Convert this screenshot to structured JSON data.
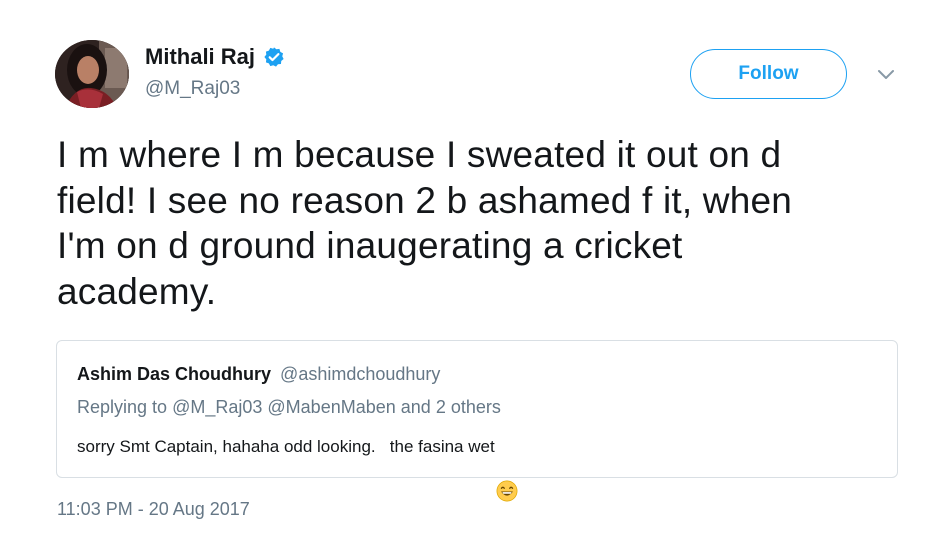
{
  "author": {
    "display_name": "Mithali Raj",
    "handle": "@M_Raj03",
    "verified": true
  },
  "follow_button": {
    "label": "Follow"
  },
  "tweet": {
    "text_lines": [
      "I m where I m because I sweated it out on d",
      "field! I see no reason 2 b ashamed f it, when",
      "I'm on d ground inaugerating a cricket",
      "academy."
    ],
    "timestamp": "11:03 PM - 20 Aug 2017"
  },
  "quoted_tweet": {
    "author_name": "Ashim Das Choudhury",
    "author_handle": "@ashimdchoudhury",
    "reply_prefix": "Replying to",
    "reply_mention_1": "@M_Raj03",
    "reply_mention_2": "@MabenMaben",
    "reply_suffix": "and 2 others",
    "body_text": "sorry Smt Captain, hahaha odd looking.   the fasina wet",
    "emoji": "grinning-face-icon"
  },
  "colors": {
    "accent": "#1da1f2",
    "secondary_text": "#657786",
    "primary_text": "#14171a",
    "border": "#d9dfe4"
  }
}
